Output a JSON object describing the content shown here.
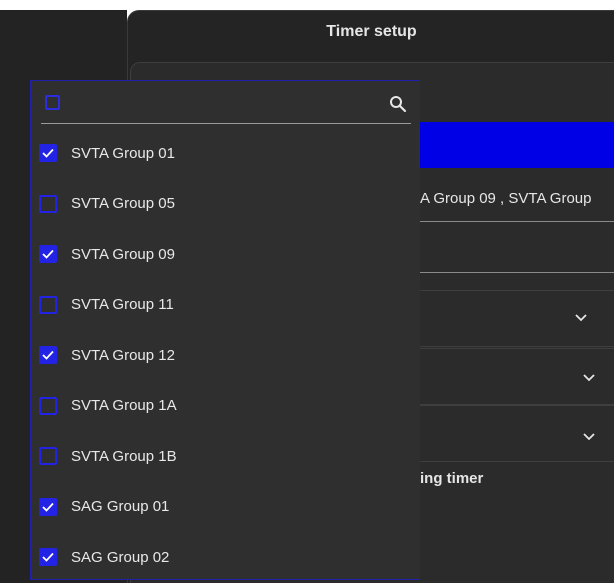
{
  "dialog": {
    "title": "Timer setup",
    "selected_groups_text": "A Group 09 , SVTA Group",
    "section_label": "ing timer"
  },
  "dropdown": {
    "search_placeholder": "",
    "items": [
      {
        "label": "SVTA Group 01",
        "checked": true
      },
      {
        "label": "SVTA Group 05",
        "checked": false
      },
      {
        "label": "SVTA Group 09",
        "checked": true
      },
      {
        "label": "SVTA Group 11",
        "checked": false
      },
      {
        "label": "SVTA Group 12",
        "checked": true
      },
      {
        "label": "SVTA Group 1A",
        "checked": false
      },
      {
        "label": "SVTA Group 1B",
        "checked": false
      },
      {
        "label": "SAG Group 01",
        "checked": true
      },
      {
        "label": "SAG Group 02",
        "checked": true
      }
    ]
  },
  "icons": {
    "search": "search-icon",
    "check": "check-icon",
    "chevron": "chevron-down-icon"
  },
  "colors": {
    "accent": "#0000e6",
    "checkbox": "#2323e6",
    "background": "#2b2b2b",
    "dropdown_bg": "#2f2f2f"
  }
}
